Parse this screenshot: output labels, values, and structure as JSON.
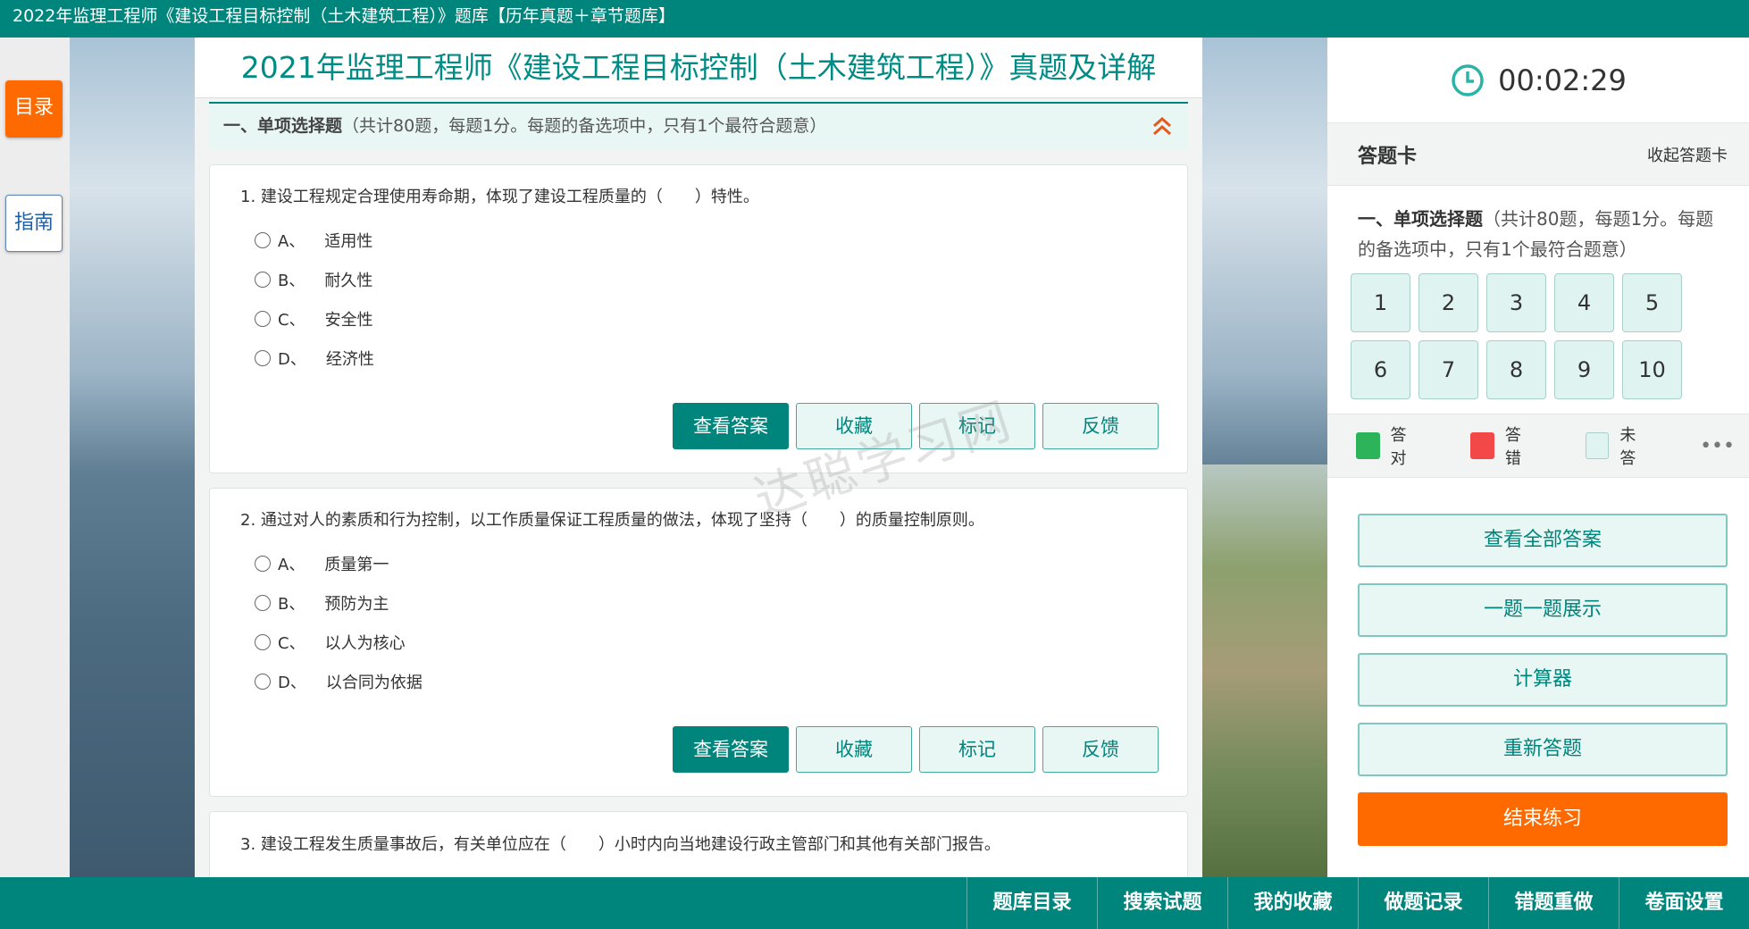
{
  "window": {
    "title": "2022年监理工程师《建设工程目标控制（土木建筑工程）》题库【历年真题＋章节题库】"
  },
  "left_nav": {
    "catalog": "目录",
    "guide": "指南"
  },
  "exam": {
    "title": "2021年监理工程师《建设工程目标控制（土木建筑工程）》真题及详解",
    "section_name": "一、单项选择题",
    "section_note": "（共计80题，每题1分。每题的备选项中，只有1个最符合题意）"
  },
  "questions": [
    {
      "text": "1. 建设工程规定合理使用寿命期，体现了建设工程质量的（　　）特性。",
      "options": [
        {
          "letter": "A、",
          "text": "适用性"
        },
        {
          "letter": "B、",
          "text": "耐久性"
        },
        {
          "letter": "C、",
          "text": "安全性"
        },
        {
          "letter": "D、",
          "text": "经济性"
        }
      ]
    },
    {
      "text": "2. 通过对人的素质和行为控制，以工作质量保证工程质量的做法，体现了坚持（　　）的质量控制原则。",
      "options": [
        {
          "letter": "A、",
          "text": "质量第一"
        },
        {
          "letter": "B、",
          "text": "预防为主"
        },
        {
          "letter": "C、",
          "text": "以人为核心"
        },
        {
          "letter": "D、",
          "text": "以合同为依据"
        }
      ]
    },
    {
      "text": "3. 建设工程发生质量事故后，有关单位应在（　　）小时内向当地建设行政主管部门和其他有关部门报告。"
    }
  ],
  "question_buttons": {
    "view_answer": "查看答案",
    "favorite": "收藏",
    "mark": "标记",
    "feedback": "反馈"
  },
  "watermark": "达聪学习网",
  "timer": {
    "value": "00:02:29"
  },
  "answer_card": {
    "title": "答题卡",
    "collapse": "收起答题卡",
    "section_name": "一、单项选择题",
    "section_note": "（共计80题，每题1分。每题的备选项中，只有1个最符合题意）",
    "numbers": [
      "1",
      "2",
      "3",
      "4",
      "5",
      "6",
      "7",
      "8",
      "9",
      "10"
    ],
    "legend": [
      {
        "label": "答对",
        "color": "#2db35a"
      },
      {
        "label": "答错",
        "color": "#f24848"
      },
      {
        "label": "未答",
        "color": "#dff3f0"
      }
    ],
    "more": "•••"
  },
  "side_buttons": {
    "view_all": "查看全部答案",
    "one_by_one": "一题一题展示",
    "calculator": "计算器",
    "redo": "重新答题",
    "end": "结束练习"
  },
  "bottom_bar": [
    "题库目录",
    "搜索试题",
    "我的收藏",
    "做题记录",
    "错题重做",
    "卷面设置"
  ],
  "colors": {
    "teal": "#00857c",
    "orange": "#ff6a00"
  }
}
